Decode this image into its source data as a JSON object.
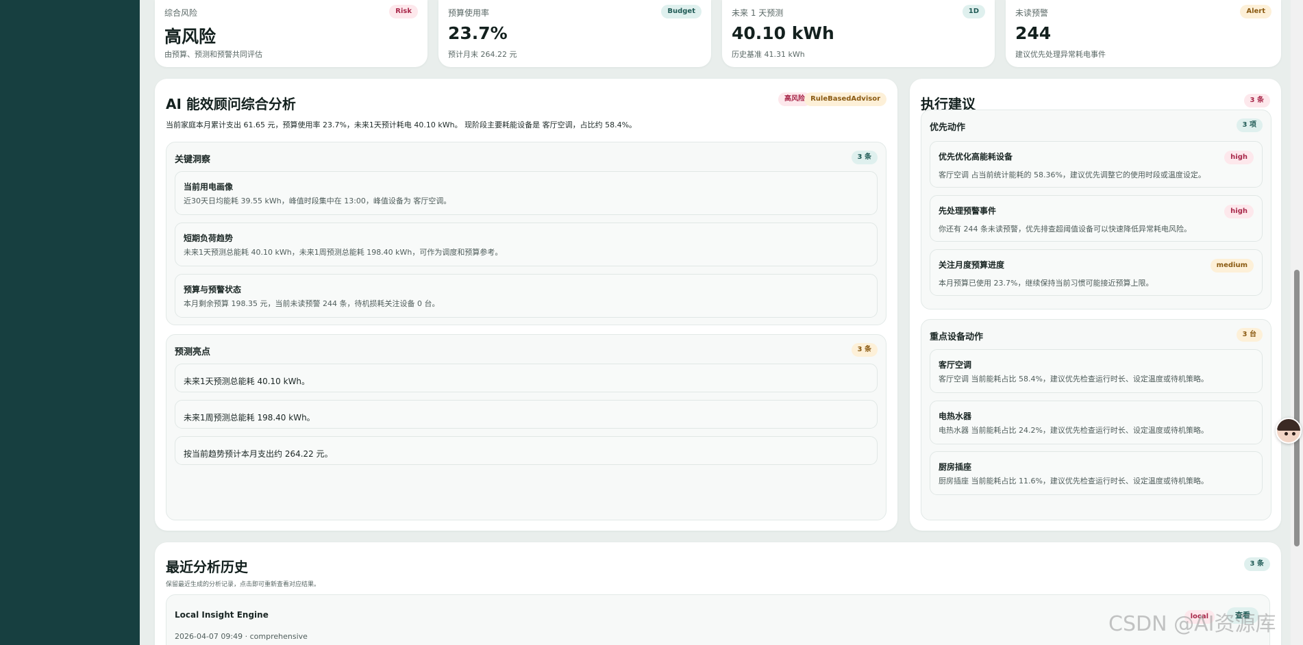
{
  "stats": [
    {
      "label": "综合风险",
      "badge": "Risk",
      "value": "高风险",
      "sub": "由预算、预测和预警共同评估"
    },
    {
      "label": "预算使用率",
      "badge": "Budget",
      "value": "23.7%",
      "sub": "预计月末 264.22 元"
    },
    {
      "label": "未来 1 天预测",
      "badge": "1D",
      "value": "40.10 kWh",
      "sub": "历史基准 41.31 kWh"
    },
    {
      "label": "未读预警",
      "badge": "Alert",
      "value": "244",
      "sub": "建议优先处理异常耗电事件"
    }
  ],
  "analysis": {
    "title": "AI 能效顾问综合分析",
    "risk_badge": "高风险",
    "engine_badge": "RuleBasedAdvisor",
    "summary": "当前家庭本月累计支出 61.65 元，预算使用率 23.7%，未来1天预计耗电 40.10 kWh。 现阶段主要耗能设备是 客厅空调，占比约 58.4%。",
    "insights": {
      "title": "关键洞察",
      "count": "3 条",
      "items": [
        {
          "title": "当前用电画像",
          "desc": "近30天日均能耗 39.55 kWh，峰值时段集中在 13:00，峰值设备为 客厅空调。"
        },
        {
          "title": "短期负荷趋势",
          "desc": "未来1天预测总能耗 40.10 kWh，未来1周预测总能耗 198.40 kWh，可作为调度和预算参考。"
        },
        {
          "title": "预算与预警状态",
          "desc": "本月剩余预算 198.35 元，当前未读预警 244 条，待机损耗关注设备 0 台。"
        }
      ]
    },
    "forecast": {
      "title": "预测亮点",
      "count": "3 条",
      "items": [
        "未来1天预测总能耗 40.10 kWh。",
        "未来1周预测总能耗 198.40 kWh。",
        "按当前趋势预计本月支出约 264.22 元。"
      ]
    }
  },
  "actions": {
    "title": "执行建议",
    "count": "3 条",
    "priority": {
      "title": "优先动作",
      "count": "3 项",
      "items": [
        {
          "title": "优先优化高能耗设备",
          "level": "high",
          "desc": "客厅空调 占当前统计能耗的 58.36%，建议优先调整它的使用时段或温度设定。"
        },
        {
          "title": "先处理预警事件",
          "level": "high",
          "desc": "你还有 244 条未读预警，优先排查超阈值设备可以快速降低异常耗电风险。"
        },
        {
          "title": "关注月度预算进度",
          "level": "medium",
          "desc": "本月预算已使用 23.7%，继续保持当前习惯可能接近预算上限。"
        }
      ]
    },
    "devices": {
      "title": "重点设备动作",
      "count": "3 台",
      "items": [
        {
          "title": "客厅空调",
          "desc": "客厅空调 当前能耗占比 58.4%，建议优先检查运行时长、设定温度或待机策略。"
        },
        {
          "title": "电热水器",
          "desc": "电热水器 当前能耗占比 24.2%，建议优先检查运行时长、设定温度或待机策略。"
        },
        {
          "title": "厨房插座",
          "desc": "厨房插座 当前能耗占比 11.6%，建议优先检查运行时长、设定温度或待机策略。"
        }
      ]
    }
  },
  "history": {
    "title": "最近分析历史",
    "subtitle": "保留最近生成的分析记录，点击即可重新查看对应结果。",
    "count": "3 条",
    "entries": [
      {
        "engine": "Local Insight Engine",
        "meta": "2026-04-07 09:49 · comprehensive",
        "tag": "local",
        "action": "查看"
      }
    ]
  },
  "watermark": "CSDN @AI资源库",
  "colors": {
    "sidebar": "#173f40",
    "background": "#e9eeec",
    "danger": "#a8284a",
    "teal": "#1f5a55",
    "amber": "#8a5a12"
  }
}
